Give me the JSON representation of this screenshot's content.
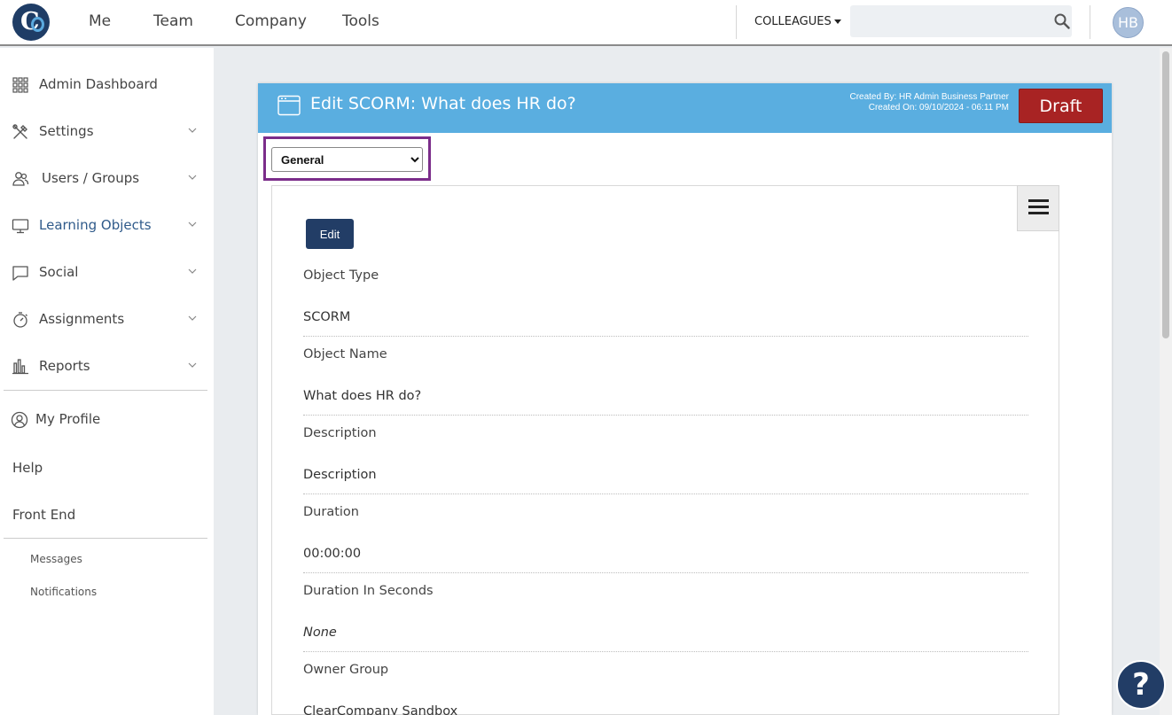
{
  "topnav": {
    "items": [
      "Me",
      "Team",
      "Company",
      "Tools"
    ],
    "colleagues_label": "COLLEAGUES",
    "search_placeholder": "",
    "avatar_initials": "HB"
  },
  "sidebar": {
    "items": [
      {
        "label": "Admin Dashboard",
        "icon": "grid-icon"
      },
      {
        "label": "Settings",
        "icon": "tools-icon"
      },
      {
        "label": "Users / Groups",
        "icon": "users-icon"
      },
      {
        "label": "Learning Objects",
        "icon": "monitor-icon"
      },
      {
        "label": "Social",
        "icon": "chat-icon"
      },
      {
        "label": "Assignments",
        "icon": "stopwatch-icon"
      },
      {
        "label": "Reports",
        "icon": "bar-chart-icon"
      }
    ],
    "my_profile": "My Profile",
    "help": "Help",
    "front_end": "Front End",
    "messages": "Messages",
    "notifications": "Notifications"
  },
  "card": {
    "title": "Edit SCORM: What does HR do?",
    "created_by": "Created By: HR Admin Business Partner",
    "created_on": "Created On: 09/10/2024 - 06:11 PM",
    "status_button": "Draft",
    "tab_select": {
      "selected": "General"
    },
    "edit_button": "Edit",
    "fields": [
      {
        "label": "Object Type",
        "value": "SCORM"
      },
      {
        "label": "Object Name",
        "value": "What does HR do?"
      },
      {
        "label": "Description",
        "value": "Description"
      },
      {
        "label": "Duration",
        "value": "00:00:00"
      },
      {
        "label": "Duration In Seconds",
        "value": "None"
      },
      {
        "label": "Owner Group",
        "value": "ClearCompany Sandbox"
      }
    ]
  },
  "help_button": "?",
  "colors": {
    "header_blue": "#5aaee0",
    "draft_red": "#a82323",
    "navy": "#223d66",
    "highlight_purple": "#7b2d8a",
    "active_nav": "#2f5a8a"
  }
}
